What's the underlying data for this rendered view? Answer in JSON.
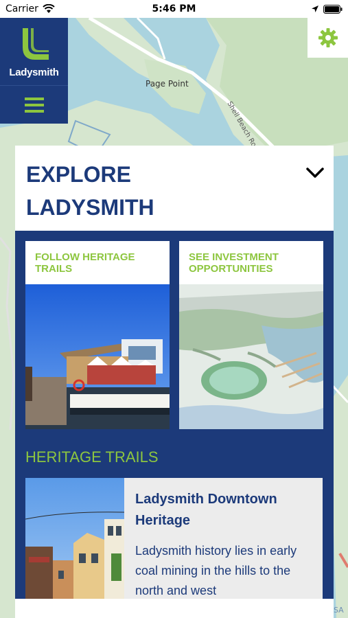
{
  "status_bar": {
    "carrier": "Carrier",
    "time": "5:46 PM"
  },
  "map": {
    "labels": {
      "page_point": "Page Point",
      "shell_beach_road": "Shell Beach Road",
      "attribution": "SA"
    },
    "colors": {
      "land": "#d6e6cf",
      "water": "#aad3df",
      "road": "#ffffff"
    }
  },
  "header": {
    "logo_text": "Ladysmith",
    "menu_icon": "hamburger-menu-icon",
    "settings_icon": "gear-icon"
  },
  "explore": {
    "title": "EXPLORE LADYSMITH",
    "toggle_icon": "chevron-down-icon",
    "cards": [
      {
        "label": "FOLLOW HERITAGE TRAILS",
        "image": "marina-photo"
      },
      {
        "label": "SEE INVESTMENT OPPORTUNITIES",
        "image": "waterfront-rendering"
      }
    ],
    "section_title": "HERITAGE TRAILS",
    "trail": {
      "title": "Ladysmith Downtown Heritage",
      "description": "Ladysmith history lies in early coal mining in the hills to the north and west",
      "image": "downtown-street-photo"
    }
  },
  "colors": {
    "brand_navy": "#1c3a7a",
    "brand_green": "#8dc63f",
    "card_bg": "#ffffff",
    "trail_bg": "#ececec"
  }
}
